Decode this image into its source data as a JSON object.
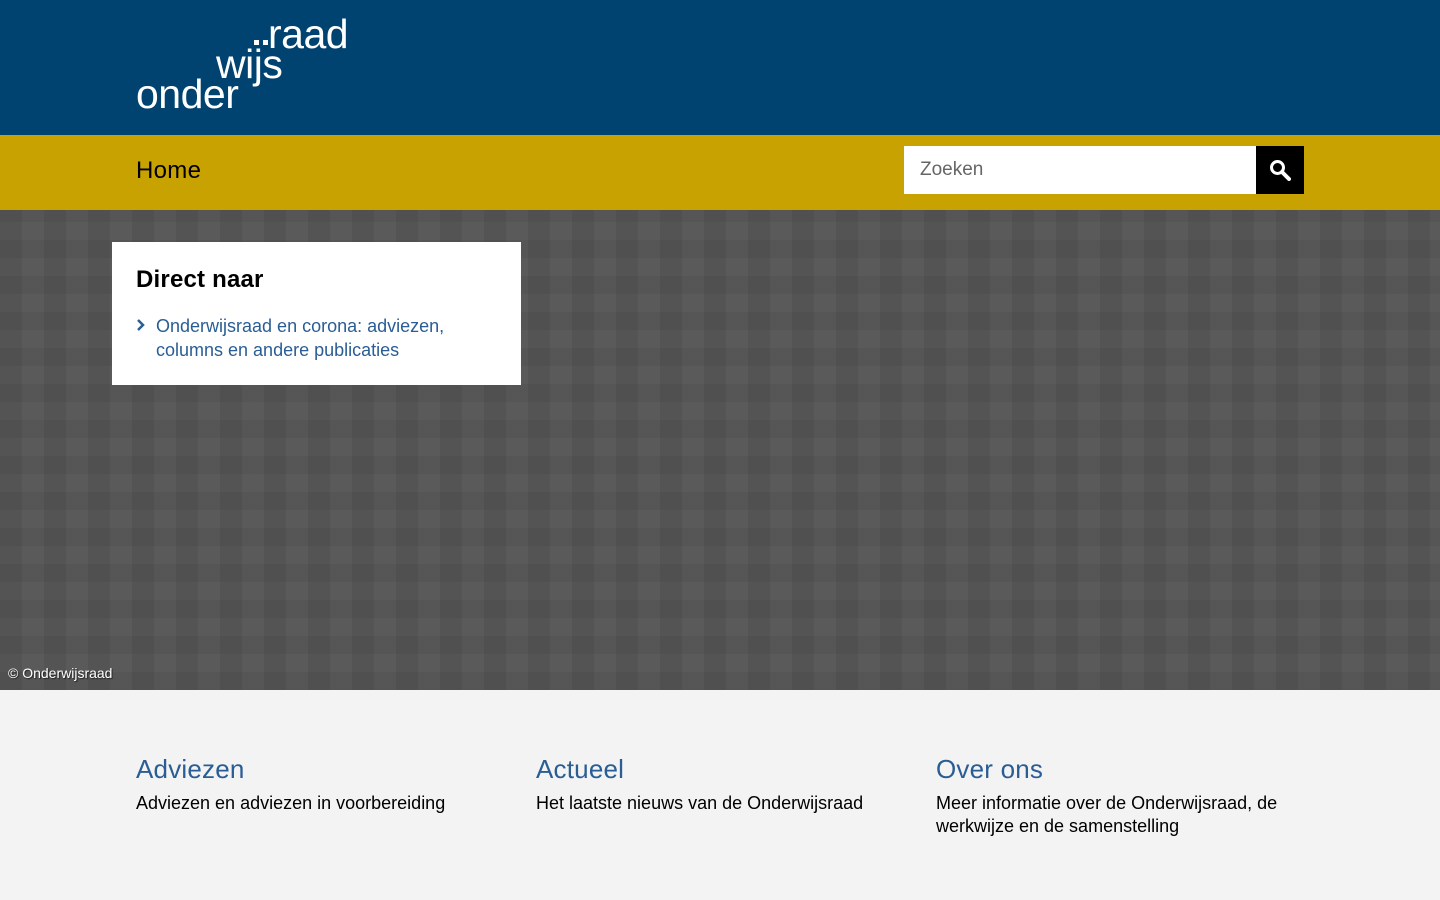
{
  "header": {
    "logo": {
      "line1": "raad",
      "line2": "wijs",
      "line3": "onder",
      "alt": "onderwijsraad"
    },
    "background_color": "#004270"
  },
  "nav": {
    "home_label": "Home",
    "background_color": "#c8a200",
    "search": {
      "placeholder": "Zoeken",
      "value": "",
      "button_icon": "search-icon"
    }
  },
  "hero": {
    "direct_title": "Direct naar",
    "direct_links": [
      {
        "label": "Onderwijsraad en corona: adviezen, columns en andere publicaties"
      }
    ],
    "copyright": "© Onderwijsraad"
  },
  "teasers": [
    {
      "title": "Adviezen",
      "text": "Adviezen en adviezen in voorbereiding"
    },
    {
      "title": "Actueel",
      "text": "Het laatste nieuws van de Onderwijsraad"
    },
    {
      "title": "Over ons",
      "text": "Meer informatie over de Onderwijsraad, de werkwijze en de samenstelling"
    }
  ],
  "colors": {
    "link": "#2a5d94",
    "accent": "#c8a200",
    "brand": "#004270"
  }
}
